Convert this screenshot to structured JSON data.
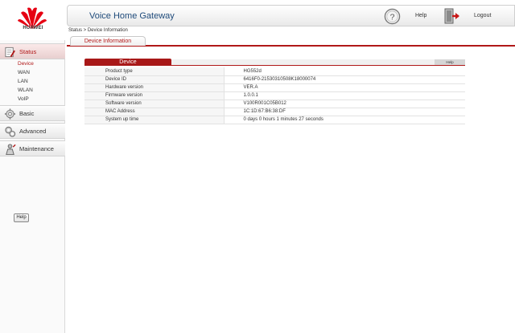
{
  "brand": {
    "name": "HUAWEI",
    "color": "#e60012"
  },
  "header": {
    "title": "Voice Home Gateway",
    "help_label": "Help",
    "logout_label": "Logout",
    "help_icon": "question-circle-icon",
    "logout_icon": "exit-door-icon"
  },
  "breadcrumb": "Status > Device Information",
  "tab": {
    "label": "Device Information"
  },
  "sidebar": {
    "sections": [
      {
        "label": "Status",
        "icon": "status-icon",
        "active": true
      },
      {
        "label": "Basic",
        "icon": "basic-icon",
        "active": false
      },
      {
        "label": "Advanced",
        "icon": "advanced-icon",
        "active": false
      },
      {
        "label": "Maintenance",
        "icon": "maintenance-icon",
        "active": false
      }
    ],
    "status_items": [
      "Device",
      "WAN",
      "LAN",
      "WLAN",
      "VoIP"
    ],
    "help_button": "Help"
  },
  "panel": {
    "title": "Device",
    "help_label": "Help",
    "rows": [
      {
        "key": "Product type",
        "value": "HG552d"
      },
      {
        "key": "Device ID",
        "value": "6416F0-21530310508K18000074"
      },
      {
        "key": "Hardware version",
        "value": "VER.A"
      },
      {
        "key": "Firmware version",
        "value": "1.0.0.1"
      },
      {
        "key": "Software version",
        "value": "V100R001C05B012"
      },
      {
        "key": "MAC Address",
        "value": "1C:1D:67:B6:38:DF"
      },
      {
        "key": "System up time",
        "value": "0 days 0 hours 1 minutes 27 seconds"
      }
    ]
  },
  "colors": {
    "accent": "#b01818",
    "title_blue": "#1e4a7a"
  }
}
